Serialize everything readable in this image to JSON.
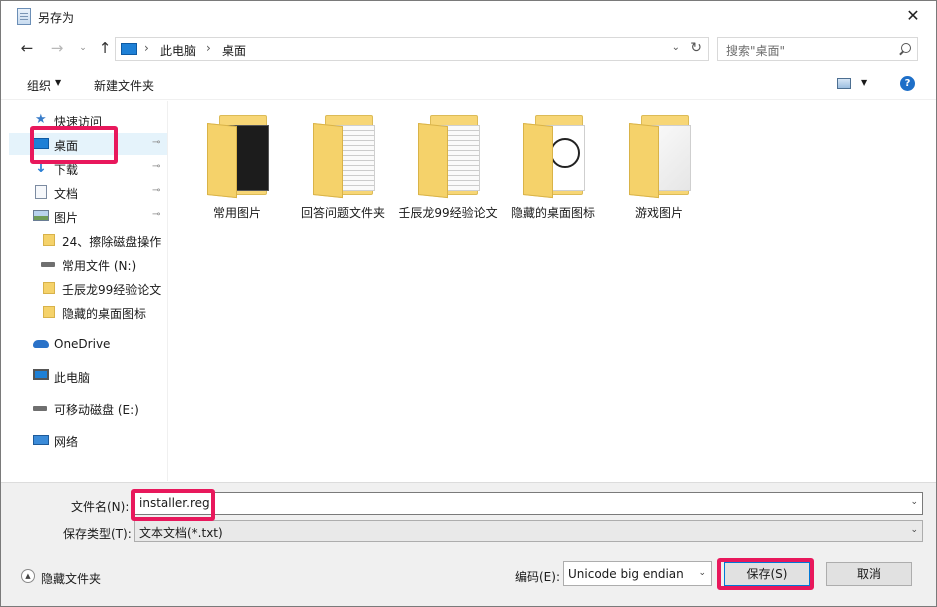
{
  "window": {
    "title": "另存为",
    "close_glyph": "✕"
  },
  "nav": {
    "back_glyph": "←",
    "forward_glyph": "→",
    "recent_glyph": "⌄",
    "up_glyph": "↑",
    "address": {
      "crumbs": [
        "此电脑",
        "桌面"
      ],
      "separator": "›",
      "dropdown_glyph": "⌄",
      "refresh_glyph": "↻"
    },
    "search": {
      "placeholder": "搜索\"桌面\""
    }
  },
  "toolbar": {
    "organize_label": "组织",
    "organize_arrow": "▼",
    "new_folder_label": "新建文件夹",
    "view_arrow": "▼",
    "help_glyph": "?"
  },
  "sidebar": {
    "pin_glyph": "⊸",
    "items": [
      {
        "label": "快速访问",
        "icon": "star-icon"
      },
      {
        "label": "桌面",
        "icon": "desktop-icon"
      },
      {
        "label": "下载",
        "icon": "download-icon"
      },
      {
        "label": "文档",
        "icon": "document-icon"
      },
      {
        "label": "图片",
        "icon": "pictures-icon"
      },
      {
        "label": "24、擦除磁盘操作",
        "icon": "folder-icon"
      },
      {
        "label": "常用文件 (N:)",
        "icon": "drive-icon"
      },
      {
        "label": "壬辰龙99经验论文",
        "icon": "folder-icon"
      },
      {
        "label": "隐藏的桌面图标",
        "icon": "folder-icon"
      },
      {
        "label": "OneDrive",
        "icon": "onedrive-icon"
      },
      {
        "label": "此电脑",
        "icon": "computer-icon"
      },
      {
        "label": "可移动磁盘 (E:)",
        "icon": "usb-drive-icon"
      },
      {
        "label": "网络",
        "icon": "network-icon"
      }
    ]
  },
  "files": [
    {
      "label": "常用图片",
      "icon": "folder-icon"
    },
    {
      "label": "回答问题文件夹",
      "icon": "folder-icon"
    },
    {
      "label": "壬辰龙99经验论文",
      "icon": "folder-icon"
    },
    {
      "label": "隐藏的桌面图标",
      "icon": "folder-icon"
    },
    {
      "label": "游戏图片",
      "icon": "folder-icon"
    }
  ],
  "form": {
    "filename_label": "文件名(N):",
    "filename_value": "installer.reg",
    "filetype_label": "保存类型(T):",
    "filetype_value": "文本文档(*.txt)",
    "dropdown_glyph": "⌄"
  },
  "footer": {
    "hide_folders_label": "隐藏文件夹",
    "hide_glyph": "▲",
    "encoding_label": "编码(E):",
    "encoding_value": "Unicode big endian",
    "save_label": "保存(S)",
    "cancel_label": "取消"
  },
  "colors": {
    "highlight": "#e8185c",
    "accent": "#0078d7",
    "folder": "#f5d26a"
  }
}
